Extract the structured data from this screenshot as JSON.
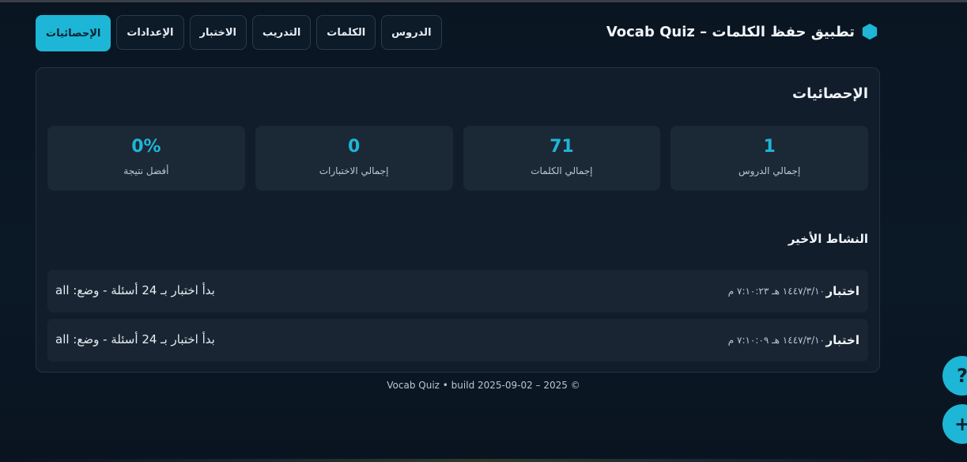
{
  "app": {
    "title": "تطبيق حفظ الكلمات – Vocab Quiz"
  },
  "nav": {
    "items": [
      {
        "label": "الإحصائيات",
        "active": true
      },
      {
        "label": "الإعدادات",
        "active": false
      },
      {
        "label": "الاختبار",
        "active": false
      },
      {
        "label": "التدريب",
        "active": false
      },
      {
        "label": "الكلمات",
        "active": false
      },
      {
        "label": "الدروس",
        "active": false
      }
    ]
  },
  "stats": {
    "title": "الإحصائيات",
    "cards": [
      {
        "value": "1",
        "label": "إجمالي الدروس"
      },
      {
        "value": "71",
        "label": "إجمالي الكلمات"
      },
      {
        "value": "0",
        "label": "إجمالي الاختبارات"
      },
      {
        "value": "0%",
        "label": "أفضل نتيجة"
      }
    ]
  },
  "activity": {
    "title": "النشاط الأخير",
    "items": [
      {
        "type": "اختبار",
        "time": "١٤٤٧/٣/١٠ هـ ٧:١٠:٢٣ م",
        "desc": "بدأ اختبار بـ 24 أسئلة - وضع: all"
      },
      {
        "type": "اختبار",
        "time": "١٤٤٧/٣/١٠ هـ ٧:١٠:٠٩ م",
        "desc": "بدأ اختبار بـ 24 أسئلة - وضع: all"
      }
    ]
  },
  "footer": {
    "text": "Vocab Quiz • build 2025-09-02 – 2025 ©"
  },
  "fabs": {
    "help_label": "?",
    "add_label": "+"
  },
  "colors": {
    "accent": "#1eb6d6",
    "background": "#0a1522",
    "card": "#111d2b",
    "stat_card": "#1b2836"
  }
}
